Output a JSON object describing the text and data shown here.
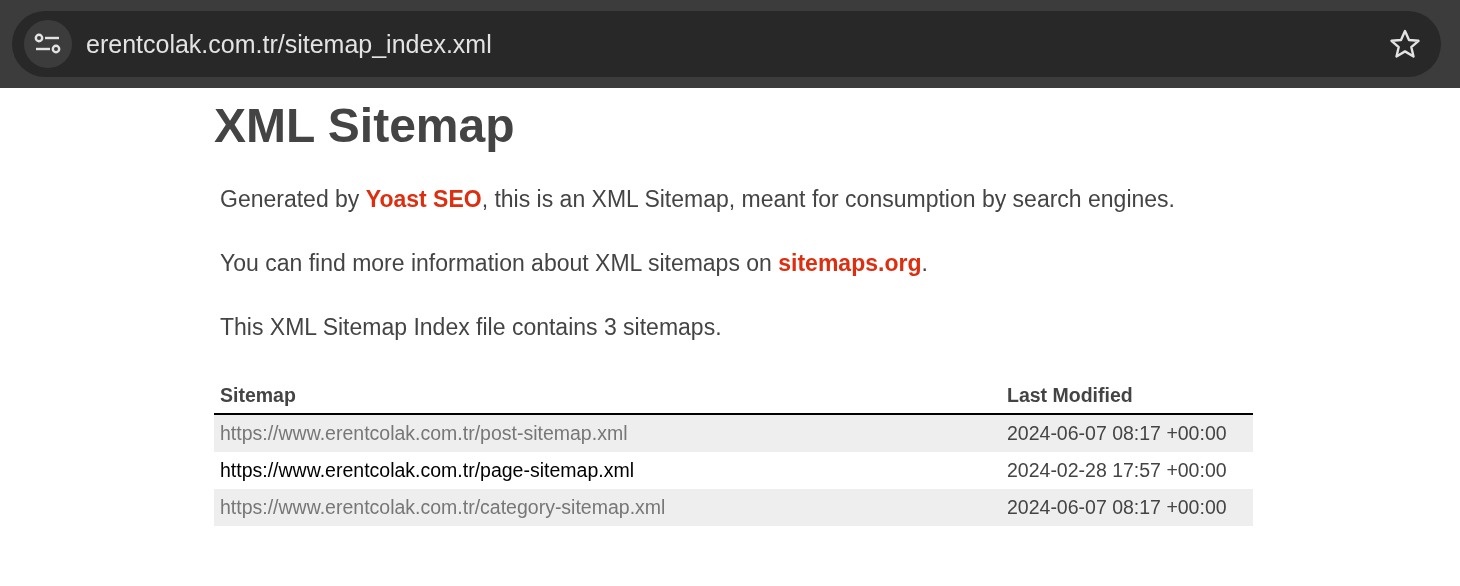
{
  "browser": {
    "url": "erentcolak.com.tr/sitemap_index.xml"
  },
  "title": "XML Sitemap",
  "paragraphs": [
    {
      "before": "Generated by ",
      "link": "Yoast SEO",
      "after": ", this is an XML Sitemap, meant for consumption by search engines."
    },
    {
      "before": "You can find more information about XML sitemaps on ",
      "link": "sitemaps.org",
      "after": "."
    },
    {
      "before": "This XML Sitemap Index file contains 3 sitemaps."
    }
  ],
  "table": {
    "columns": [
      "Sitemap",
      "Last Modified"
    ],
    "rows": [
      {
        "url": "https://www.erentcolak.com.tr/post-sitemap.xml",
        "modified": "2024-06-07 08:17 +00:00",
        "hovered": false
      },
      {
        "url": "https://www.erentcolak.com.tr/page-sitemap.xml",
        "modified": "2024-02-28 17:57 +00:00",
        "hovered": true
      },
      {
        "url": "https://www.erentcolak.com.tr/category-sitemap.xml",
        "modified": "2024-06-07 08:17 +00:00",
        "hovered": false
      }
    ]
  }
}
